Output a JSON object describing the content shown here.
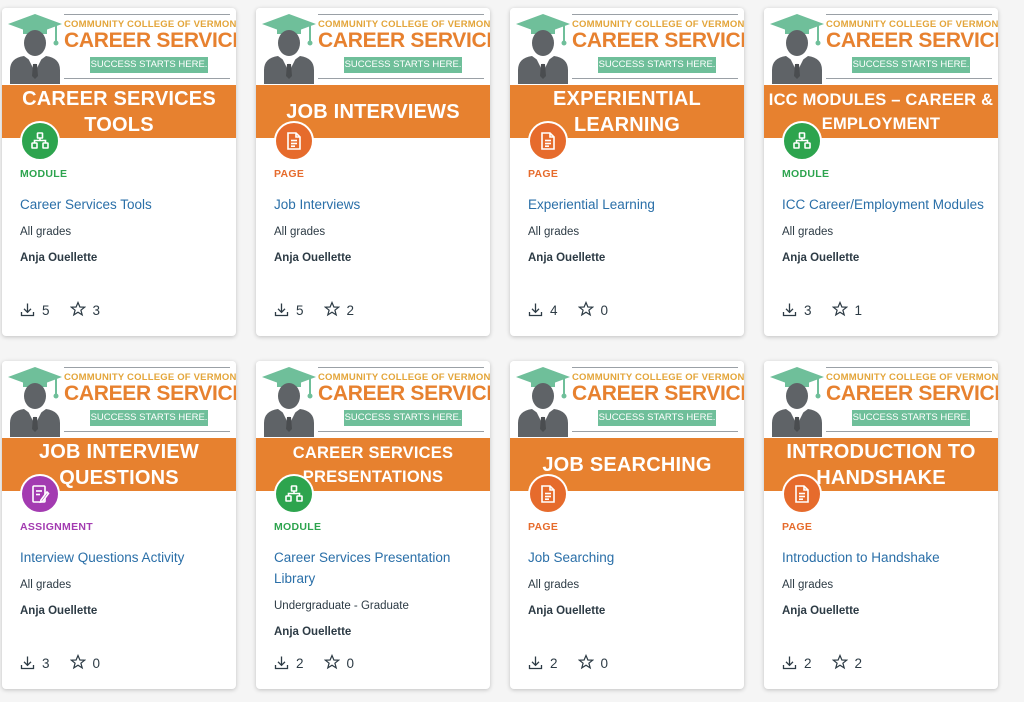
{
  "header": {
    "college": "COMMUNITY COLLEGE OF VERMONT",
    "department": "CAREER SERVICES",
    "tagline": "SUCCESS STARTS HERE."
  },
  "colors": {
    "orange": "#e7812f",
    "module": "#2da44e",
    "page": "#e66b2c",
    "assignment": "#a33bb1",
    "link": "#2a6fa8"
  },
  "cards": [
    {
      "banner": "CAREER SERVICES TOOLS",
      "type": "MODULE",
      "icon": "module-icon",
      "title": "Career Services Tools",
      "grades": "All grades",
      "author": "Anja Ouellette",
      "downloads": "5",
      "favorites": "3"
    },
    {
      "banner": "JOB INTERVIEWS",
      "type": "PAGE",
      "icon": "page-icon",
      "title": "Job Interviews",
      "grades": "All grades",
      "author": "Anja Ouellette",
      "downloads": "5",
      "favorites": "2"
    },
    {
      "banner": "EXPERIENTIAL LEARNING",
      "type": "PAGE",
      "icon": "page-icon",
      "title": "Experiential Learning",
      "grades": "All grades",
      "author": "Anja Ouellette",
      "downloads": "4",
      "favorites": "0"
    },
    {
      "banner": "ICC MODULES – CAREER & EMPLOYMENT",
      "type": "MODULE",
      "icon": "module-icon",
      "title": "ICC Career/Employment Modules",
      "grades": "All grades",
      "author": "Anja Ouellette",
      "downloads": "3",
      "favorites": "1"
    },
    {
      "banner": "JOB INTERVIEW QUESTIONS",
      "type": "ASSIGNMENT",
      "icon": "assignment-icon",
      "title": "Interview Questions Activity",
      "grades": "All grades",
      "author": "Anja Ouellette",
      "downloads": "3",
      "favorites": "0"
    },
    {
      "banner": "CAREER SERVICES PRESENTATIONS",
      "type": "MODULE",
      "icon": "module-icon",
      "title": "Career Services Presentation Library",
      "grades": "Undergraduate - Graduate",
      "author": "Anja Ouellette",
      "downloads": "2",
      "favorites": "0"
    },
    {
      "banner": "JOB SEARCHING",
      "type": "PAGE",
      "icon": "page-icon",
      "title": "Job Searching",
      "grades": "All grades",
      "author": "Anja Ouellette",
      "downloads": "2",
      "favorites": "0"
    },
    {
      "banner": "INTRODUCTION TO HANDSHAKE",
      "type": "PAGE",
      "icon": "page-icon",
      "title": "Introduction to Handshake",
      "grades": "All grades",
      "author": "Anja Ouellette",
      "downloads": "2",
      "favorites": "2"
    }
  ]
}
